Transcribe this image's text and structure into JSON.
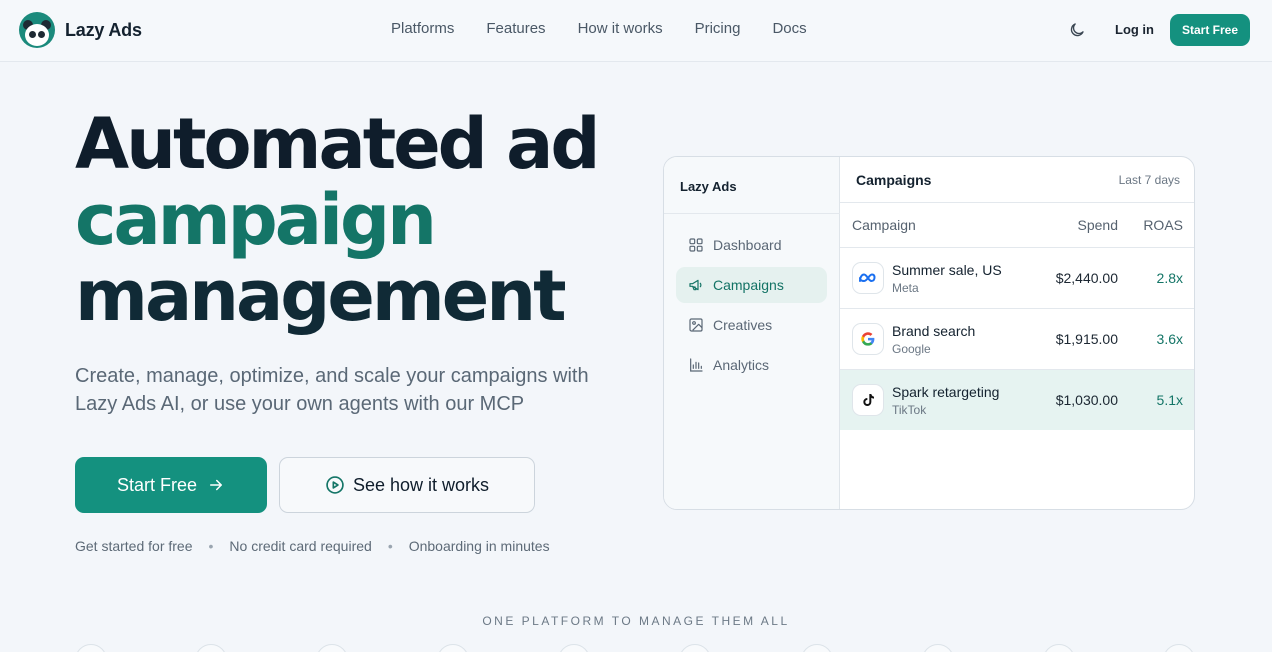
{
  "brand": {
    "name": "Lazy Ads",
    "accent": "#14917f",
    "accent_dark": "#147567"
  },
  "nav": {
    "links": [
      "Platforms",
      "Features",
      "How it works",
      "Pricing",
      "Docs"
    ],
    "theme_icon": "moon-icon",
    "login_label": "Log in",
    "start_label": "Start Free"
  },
  "hero": {
    "line1": "Automated ad",
    "line2": "campaign",
    "line3": "management",
    "subtitle": "Create, manage, optimize, and scale your campaigns with Lazy Ads AI, or use your own agents with our MCP",
    "primary_cta": "Start Free",
    "secondary_cta": "See how it works",
    "perks": [
      "Get started for free",
      "No credit card required",
      "Onboarding in minutes"
    ]
  },
  "panel": {
    "brand": "Lazy Ads",
    "sidebar": [
      {
        "label": "Dashboard",
        "icon": "grid-icon",
        "active": false
      },
      {
        "label": "Campaigns",
        "icon": "megaphone-icon",
        "active": true
      },
      {
        "label": "Creatives",
        "icon": "image-icon",
        "active": false
      },
      {
        "label": "Analytics",
        "icon": "bar-chart-icon",
        "active": false
      }
    ],
    "title": "Campaigns",
    "range": "Last 7 days",
    "columns": [
      "Campaign",
      "Spend",
      "ROAS"
    ],
    "rows": [
      {
        "name": "Summer sale, US",
        "platform": "Meta",
        "spend": "$2,440.00",
        "roas": "2.8x",
        "icon": "meta-icon"
      },
      {
        "name": "Brand search",
        "platform": "Google",
        "spend": "$1,915.00",
        "roas": "3.6x",
        "icon": "google-icon"
      },
      {
        "name": "Spark retargeting",
        "platform": "TikTok",
        "spend": "$1,030.00",
        "roas": "5.1x",
        "icon": "tiktok-icon"
      }
    ]
  },
  "platforms_eyebrow": "ONE PLATFORM TO MANAGE THEM ALL"
}
